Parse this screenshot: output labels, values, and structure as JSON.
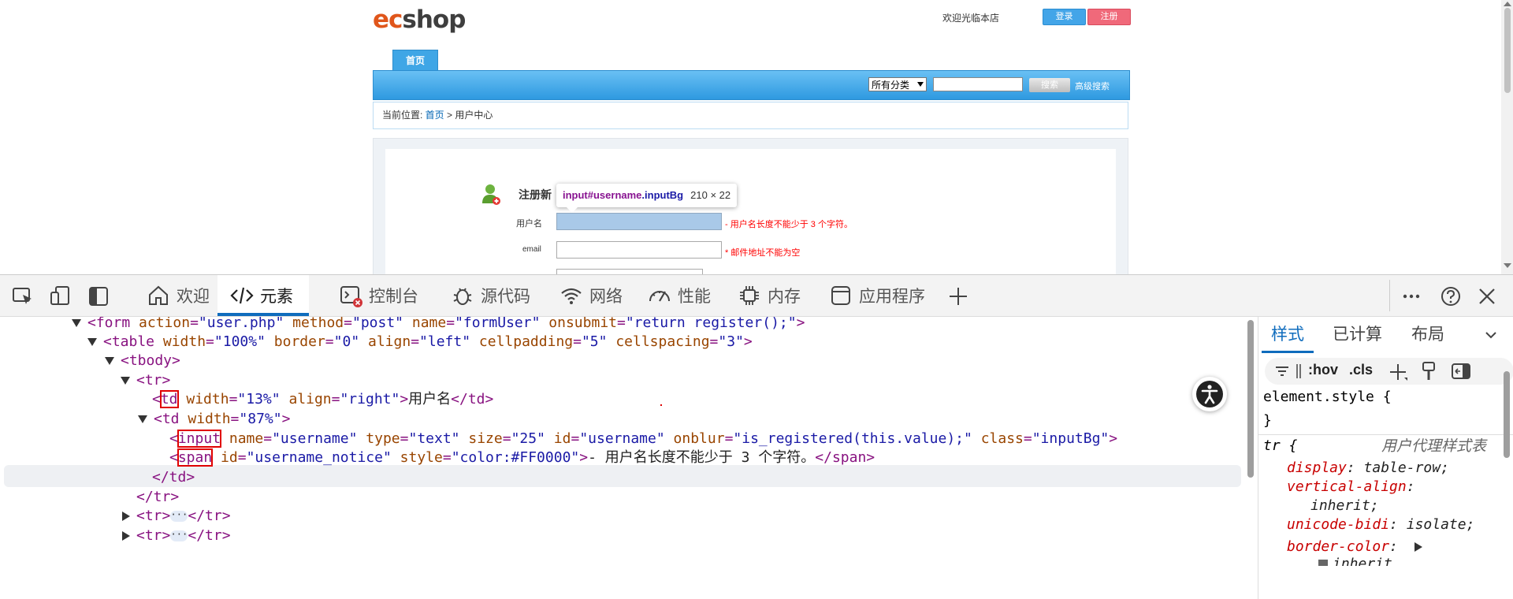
{
  "webpage": {
    "logo": {
      "ec": "ec",
      "shop": "shop"
    },
    "welcome_text": "欢迎光临本店",
    "login_label": "登录",
    "register_label": "注册",
    "nav_tab": "首页",
    "category_select": "所有分类",
    "search_placeholder": "",
    "search_button": "搜索",
    "advanced_search": "高级搜索",
    "breadcrumb": {
      "label": "当前位置: ",
      "home": "首页",
      "sep": " > ",
      "current": "用户中心"
    },
    "register_title": "注册新",
    "tooltip": {
      "tag": "input",
      "id": "#username",
      "cls": ".inputBg",
      "size": "210 × 22"
    },
    "form": {
      "username_label": "用户名",
      "username_notice": "- 用户名长度不能少于 3 个字符。",
      "email_label": "email",
      "email_notice": "* 邮件地址不能为空"
    }
  },
  "devtools": {
    "tabs": [
      {
        "label": "欢迎",
        "icon": "home-icon"
      },
      {
        "label": "元素",
        "icon": "code-icon",
        "active": true
      },
      {
        "label": "控制台",
        "icon": "console-icon"
      },
      {
        "label": "源代码",
        "icon": "bug-icon"
      },
      {
        "label": "网络",
        "icon": "wifi-icon"
      },
      {
        "label": "性能",
        "icon": "gauge-icon"
      },
      {
        "label": "内存",
        "icon": "chip-icon"
      },
      {
        "label": "应用程序",
        "icon": "app-icon"
      }
    ],
    "elements": {
      "form_line": {
        "tag_open": "<form ",
        "a1": "action",
        "v1": "\"user.php\"",
        "a2": "method",
        "v2": "\"post\"",
        "a3": "name",
        "v3": "\"formUser\"",
        "a4": "onsubmit",
        "v4": "\"return register();\"",
        "tag_close": ">"
      },
      "table_line": {
        "tag_open": "<table ",
        "a1": "width",
        "v1": "\"100%\"",
        "a2": "border",
        "v2": "\"0\"",
        "a3": "align",
        "v3": "\"left\"",
        "a4": "cellpadding",
        "v4": "\"5\"",
        "a5": "cellspacing",
        "v5": "\"3\"",
        "tag_close": ">"
      },
      "tbody_line": "<tbody>",
      "tr_line": "<tr>",
      "td1_line": {
        "lt": "<",
        "tag": "td",
        "a1": "width",
        "v1": "\"13%\"",
        "a2": "align",
        "v2": "\"right\"",
        "gt": ">",
        "text": "用户名",
        "close": "</td>"
      },
      "td2_line": {
        "tag_open": "<td ",
        "a1": "width",
        "v1": "\"87%\"",
        "gt": ">"
      },
      "input_line": {
        "lt": "<",
        "tag": "input",
        "a1": "name",
        "v1": "\"username\"",
        "a2": "type",
        "v2": "\"text\"",
        "a3": "size",
        "v3": "\"25\"",
        "a4": "id",
        "v4": "\"username\"",
        "a5": "onblur",
        "v5": "\"is_registered(this.value);\"",
        "a6": "class",
        "v6": "\"inputBg\"",
        "gt": ">"
      },
      "span_line": {
        "lt": "<",
        "tag": "span",
        "a1": "id",
        "v1": "\"username_notice\"",
        "a2": "style",
        "v2": "\"color:#FF0000\"",
        "gt": ">",
        "text": "- 用户名长度不能少于 3 个字符。",
        "close": "</span>"
      },
      "td_close": "</td>",
      "tr_close": "</tr>",
      "tr_collapsed": {
        "open": "<tr>",
        "dots": "···",
        "close": "</tr>"
      }
    },
    "styles": {
      "tabs": [
        "样式",
        "已计算",
        "布局"
      ],
      "filter_hov": ":hov",
      "filter_cls": ".cls",
      "element_style": "element.style {",
      "close_brace": "}",
      "tr_rule": "tr {",
      "ua_label": "用户代理样式表",
      "props": [
        {
          "name": "display",
          "value": "table-row;"
        },
        {
          "name": "vertical-align",
          "value": ""
        },
        {
          "name": "",
          "value": "inherit;"
        },
        {
          "name": "unicode-bidi",
          "value": "isolate;"
        },
        {
          "name": "border-color",
          "value": ""
        },
        {
          "name": "",
          "value": "inherit"
        }
      ]
    },
    "colors": {
      "accent": "#0f6cbd",
      "tag": "#881280",
      "attr": "#994500",
      "value": "#1a1aa6"
    }
  }
}
